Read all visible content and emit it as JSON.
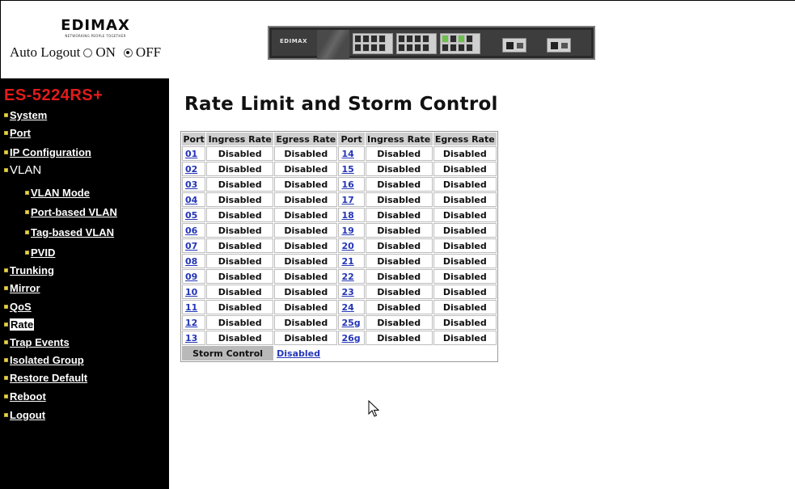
{
  "header": {
    "logo_text": "EDIMAX",
    "logo_tagline": "NETWORKING PEOPLE TOGETHER",
    "auto_logout_label": "Auto Logout",
    "auto_logout_on": "ON",
    "auto_logout_off": "OFF",
    "auto_logout_selected": "OFF",
    "switch_brand": "EDIMAX"
  },
  "sidebar": {
    "model": "ES-5224RS+",
    "items": [
      {
        "label": "System"
      },
      {
        "label": "Port"
      },
      {
        "label": "IP Configuration"
      },
      {
        "label": "VLAN"
      },
      {
        "label": "VLAN Mode"
      },
      {
        "label": "Port-based VLAN"
      },
      {
        "label": "Tag-based VLAN"
      },
      {
        "label": "PVID"
      },
      {
        "label": "Trunking"
      },
      {
        "label": "Mirror"
      },
      {
        "label": "QoS"
      },
      {
        "label": "Rate"
      },
      {
        "label": "Trap Events"
      },
      {
        "label": "Isolated Group"
      },
      {
        "label": "Restore Default"
      },
      {
        "label": "Reboot"
      },
      {
        "label": "Logout"
      }
    ],
    "active": "Rate"
  },
  "main": {
    "title": "Rate Limit and Storm Control",
    "headers": [
      "Port",
      "Ingress Rate",
      "Egress Rate",
      "Port",
      "Ingress Rate",
      "Egress Rate"
    ],
    "rows": [
      [
        "01",
        "Disabled",
        "Disabled",
        "14",
        "Disabled",
        "Disabled"
      ],
      [
        "02",
        "Disabled",
        "Disabled",
        "15",
        "Disabled",
        "Disabled"
      ],
      [
        "03",
        "Disabled",
        "Disabled",
        "16",
        "Disabled",
        "Disabled"
      ],
      [
        "04",
        "Disabled",
        "Disabled",
        "17",
        "Disabled",
        "Disabled"
      ],
      [
        "05",
        "Disabled",
        "Disabled",
        "18",
        "Disabled",
        "Disabled"
      ],
      [
        "06",
        "Disabled",
        "Disabled",
        "19",
        "Disabled",
        "Disabled"
      ],
      [
        "07",
        "Disabled",
        "Disabled",
        "20",
        "Disabled",
        "Disabled"
      ],
      [
        "08",
        "Disabled",
        "Disabled",
        "21",
        "Disabled",
        "Disabled"
      ],
      [
        "09",
        "Disabled",
        "Disabled",
        "22",
        "Disabled",
        "Disabled"
      ],
      [
        "10",
        "Disabled",
        "Disabled",
        "23",
        "Disabled",
        "Disabled"
      ],
      [
        "11",
        "Disabled",
        "Disabled",
        "24",
        "Disabled",
        "Disabled"
      ],
      [
        "12",
        "Disabled",
        "Disabled",
        "25g",
        "Disabled",
        "Disabled"
      ],
      [
        "13",
        "Disabled",
        "Disabled",
        "26g",
        "Disabled",
        "Disabled"
      ]
    ],
    "storm_control_label": "Storm Control",
    "storm_control_value": "Disabled"
  },
  "colors": {
    "model_text": "#e31b1b",
    "sidebar_bg": "#000000",
    "link": "#2335b8",
    "table_header_bg": "#cfcfcf",
    "bullet": "#e8d44d"
  },
  "icons": {
    "nav_bullet": "bullet-icon",
    "cursor": "mouse-pointer-icon"
  }
}
